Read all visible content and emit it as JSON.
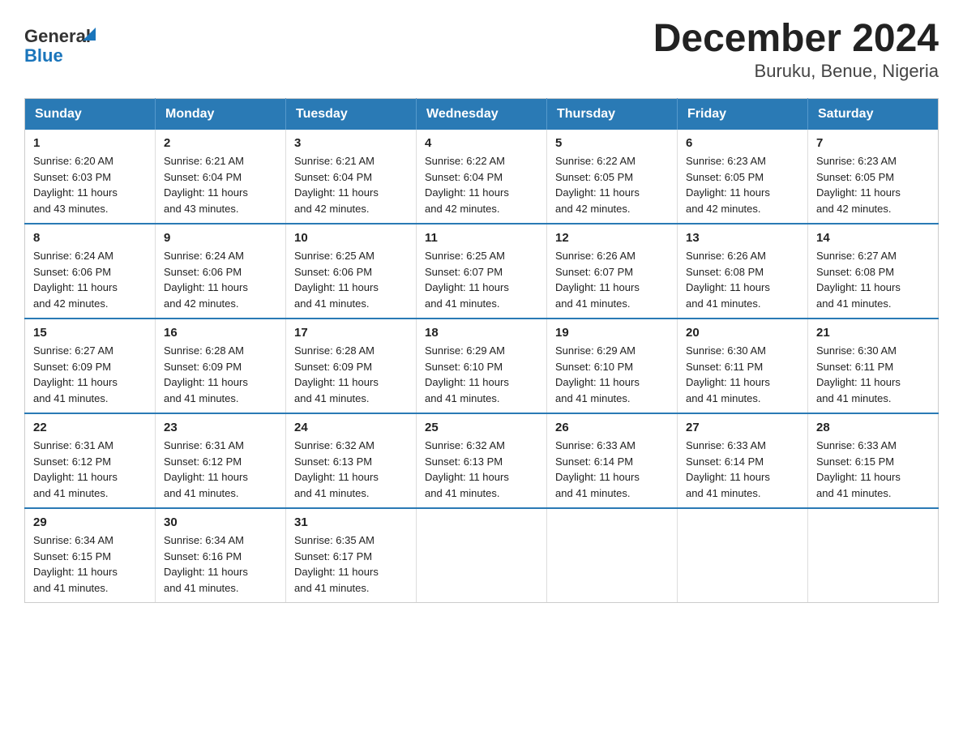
{
  "logo": {
    "text_general": "General",
    "text_blue": "Blue"
  },
  "title": "December 2024",
  "subtitle": "Buruku, Benue, Nigeria",
  "days_of_week": [
    "Sunday",
    "Monday",
    "Tuesday",
    "Wednesday",
    "Thursday",
    "Friday",
    "Saturday"
  ],
  "weeks": [
    [
      {
        "day": "1",
        "sunrise": "6:20 AM",
        "sunset": "6:03 PM",
        "daylight": "11 hours and 43 minutes."
      },
      {
        "day": "2",
        "sunrise": "6:21 AM",
        "sunset": "6:04 PM",
        "daylight": "11 hours and 43 minutes."
      },
      {
        "day": "3",
        "sunrise": "6:21 AM",
        "sunset": "6:04 PM",
        "daylight": "11 hours and 42 minutes."
      },
      {
        "day": "4",
        "sunrise": "6:22 AM",
        "sunset": "6:04 PM",
        "daylight": "11 hours and 42 minutes."
      },
      {
        "day": "5",
        "sunrise": "6:22 AM",
        "sunset": "6:05 PM",
        "daylight": "11 hours and 42 minutes."
      },
      {
        "day": "6",
        "sunrise": "6:23 AM",
        "sunset": "6:05 PM",
        "daylight": "11 hours and 42 minutes."
      },
      {
        "day": "7",
        "sunrise": "6:23 AM",
        "sunset": "6:05 PM",
        "daylight": "11 hours and 42 minutes."
      }
    ],
    [
      {
        "day": "8",
        "sunrise": "6:24 AM",
        "sunset": "6:06 PM",
        "daylight": "11 hours and 42 minutes."
      },
      {
        "day": "9",
        "sunrise": "6:24 AM",
        "sunset": "6:06 PM",
        "daylight": "11 hours and 42 minutes."
      },
      {
        "day": "10",
        "sunrise": "6:25 AM",
        "sunset": "6:06 PM",
        "daylight": "11 hours and 41 minutes."
      },
      {
        "day": "11",
        "sunrise": "6:25 AM",
        "sunset": "6:07 PM",
        "daylight": "11 hours and 41 minutes."
      },
      {
        "day": "12",
        "sunrise": "6:26 AM",
        "sunset": "6:07 PM",
        "daylight": "11 hours and 41 minutes."
      },
      {
        "day": "13",
        "sunrise": "6:26 AM",
        "sunset": "6:08 PM",
        "daylight": "11 hours and 41 minutes."
      },
      {
        "day": "14",
        "sunrise": "6:27 AM",
        "sunset": "6:08 PM",
        "daylight": "11 hours and 41 minutes."
      }
    ],
    [
      {
        "day": "15",
        "sunrise": "6:27 AM",
        "sunset": "6:09 PM",
        "daylight": "11 hours and 41 minutes."
      },
      {
        "day": "16",
        "sunrise": "6:28 AM",
        "sunset": "6:09 PM",
        "daylight": "11 hours and 41 minutes."
      },
      {
        "day": "17",
        "sunrise": "6:28 AM",
        "sunset": "6:09 PM",
        "daylight": "11 hours and 41 minutes."
      },
      {
        "day": "18",
        "sunrise": "6:29 AM",
        "sunset": "6:10 PM",
        "daylight": "11 hours and 41 minutes."
      },
      {
        "day": "19",
        "sunrise": "6:29 AM",
        "sunset": "6:10 PM",
        "daylight": "11 hours and 41 minutes."
      },
      {
        "day": "20",
        "sunrise": "6:30 AM",
        "sunset": "6:11 PM",
        "daylight": "11 hours and 41 minutes."
      },
      {
        "day": "21",
        "sunrise": "6:30 AM",
        "sunset": "6:11 PM",
        "daylight": "11 hours and 41 minutes."
      }
    ],
    [
      {
        "day": "22",
        "sunrise": "6:31 AM",
        "sunset": "6:12 PM",
        "daylight": "11 hours and 41 minutes."
      },
      {
        "day": "23",
        "sunrise": "6:31 AM",
        "sunset": "6:12 PM",
        "daylight": "11 hours and 41 minutes."
      },
      {
        "day": "24",
        "sunrise": "6:32 AM",
        "sunset": "6:13 PM",
        "daylight": "11 hours and 41 minutes."
      },
      {
        "day": "25",
        "sunrise": "6:32 AM",
        "sunset": "6:13 PM",
        "daylight": "11 hours and 41 minutes."
      },
      {
        "day": "26",
        "sunrise": "6:33 AM",
        "sunset": "6:14 PM",
        "daylight": "11 hours and 41 minutes."
      },
      {
        "day": "27",
        "sunrise": "6:33 AM",
        "sunset": "6:14 PM",
        "daylight": "11 hours and 41 minutes."
      },
      {
        "day": "28",
        "sunrise": "6:33 AM",
        "sunset": "6:15 PM",
        "daylight": "11 hours and 41 minutes."
      }
    ],
    [
      {
        "day": "29",
        "sunrise": "6:34 AM",
        "sunset": "6:15 PM",
        "daylight": "11 hours and 41 minutes."
      },
      {
        "day": "30",
        "sunrise": "6:34 AM",
        "sunset": "6:16 PM",
        "daylight": "11 hours and 41 minutes."
      },
      {
        "day": "31",
        "sunrise": "6:35 AM",
        "sunset": "6:17 PM",
        "daylight": "11 hours and 41 minutes."
      },
      null,
      null,
      null,
      null
    ]
  ],
  "labels": {
    "sunrise": "Sunrise:",
    "sunset": "Sunset:",
    "daylight": "Daylight:"
  },
  "colors": {
    "header_bg": "#2a7ab5",
    "border_accent": "#2a7ab5"
  }
}
